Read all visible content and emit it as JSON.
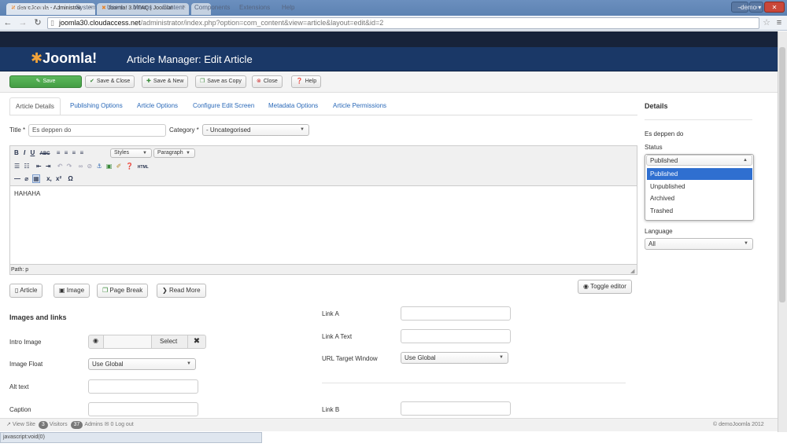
{
  "browser": {
    "tabs": [
      {
        "label": "demoJoomla - Administrat"
      },
      {
        "label": "Joomla! 3.0 FAQ | Joomla!"
      }
    ],
    "url_host": "joomla30.cloudaccess.net",
    "url_path": "/administrator/index.php?option=com_content&view=article&layout=edit&id=2",
    "status": "javascript:void(0)"
  },
  "topbar": {
    "site": "demoJoomla",
    "menu": [
      "System",
      "Users",
      "Menus",
      "Content",
      "Components",
      "Extensions",
      "Help"
    ],
    "user": "demo"
  },
  "header": {
    "logo": "Joomla!",
    "title": "Article Manager: Edit Article"
  },
  "toolbar": {
    "save": "Save",
    "save_close": "Save & Close",
    "save_new": "Save & New",
    "save_copy": "Save as Copy",
    "close": "Close",
    "help": "Help"
  },
  "tabs": [
    "Article Details",
    "Publishing Options",
    "Article Options",
    "Configure Edit Screen",
    "Metadata Options",
    "Article Permissions"
  ],
  "form": {
    "title_label": "Title *",
    "title_value": "Es deppen do",
    "category_label": "Category *",
    "category_value": "- Uncategorised",
    "styles": "Styles",
    "paragraph": "Paragraph",
    "body": "HAHAHA",
    "path": "Path: p"
  },
  "editor_buttons": {
    "article": "Article",
    "image": "Image",
    "page_break": "Page Break",
    "read_more": "Read More",
    "toggle": "Toggle editor"
  },
  "images_links": {
    "heading": "Images and links",
    "intro_image": "Intro Image",
    "select": "Select",
    "image_float": "Image Float",
    "image_float_value": "Use Global",
    "alt_text": "Alt text",
    "caption": "Caption",
    "link_a": "Link A",
    "link_a_text": "Link A Text",
    "url_target": "URL Target Window",
    "url_target_value": "Use Global",
    "link_b": "Link B"
  },
  "details": {
    "heading": "Details",
    "title": "Es deppen do",
    "status_label": "Status",
    "status_value": "Published",
    "status_options": [
      "Published",
      "Unpublished",
      "Archived",
      "Trashed"
    ],
    "language_label": "Language",
    "language_value": "All"
  },
  "statusbar": {
    "view_site": "View Site",
    "visitors_count": "3",
    "visitors": "Visitors",
    "admins_count": "37",
    "admins": "Admins",
    "logout_count": "0",
    "logout": "Log out",
    "copyright": "© demoJoomla 2012"
  },
  "colors": {
    "header_bg": "#1a3867",
    "topbar_bg": "#17233a",
    "save_green": "#4ea64e",
    "link_blue": "#2a69b8",
    "dropdown_selected": "#2f6fd0"
  }
}
